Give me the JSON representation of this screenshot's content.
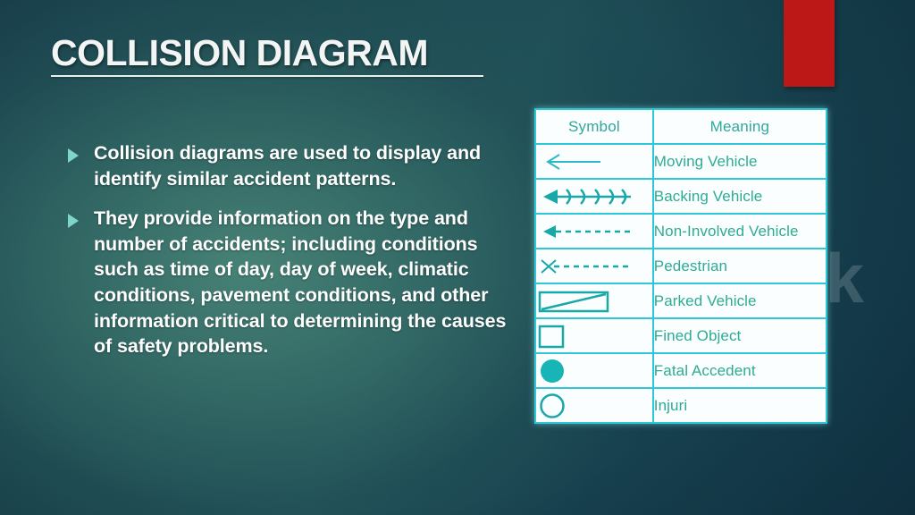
{
  "slide": {
    "title": "COLLISION DIAGRAM",
    "watermark": "Testbook",
    "accent_red": "#bc1818",
    "accent_cyan": "#2fc6d8",
    "table_text_color": "#2eab95",
    "bullet_marker_color": "#7fd6c8",
    "background_dark": "#123748",
    "background_light": "#498578"
  },
  "bullets": [
    {
      "text": "Collision diagrams are used to display and identify similar accident patterns."
    },
    {
      "text": "They provide information on the type and number of accidents; including conditions such as time of day, day of week, climatic conditions, pavement conditions, and other information critical to determining the causes of safety problems."
    }
  ],
  "table": {
    "headers": [
      "Symbol",
      "Meaning"
    ],
    "rows": [
      {
        "symbol": "left-arrow-solid-icon",
        "meaning": "Moving Vehicle"
      },
      {
        "symbol": "left-arrow-chevrons-icon",
        "meaning": "Backing Vehicle"
      },
      {
        "symbol": "left-arrow-dashed-icon",
        "meaning": "Non-Involved Vehicle"
      },
      {
        "symbol": "x-dashed-line-icon",
        "meaning": "Pedestrian"
      },
      {
        "symbol": "rectangle-diagonal-icon",
        "meaning": "Parked Vehicle"
      },
      {
        "symbol": "square-outline-icon",
        "meaning": "Fined Object"
      },
      {
        "symbol": "filled-circle-icon",
        "meaning": "Fatal Accedent"
      },
      {
        "symbol": "open-circle-icon",
        "meaning": "Injuri"
      }
    ]
  }
}
